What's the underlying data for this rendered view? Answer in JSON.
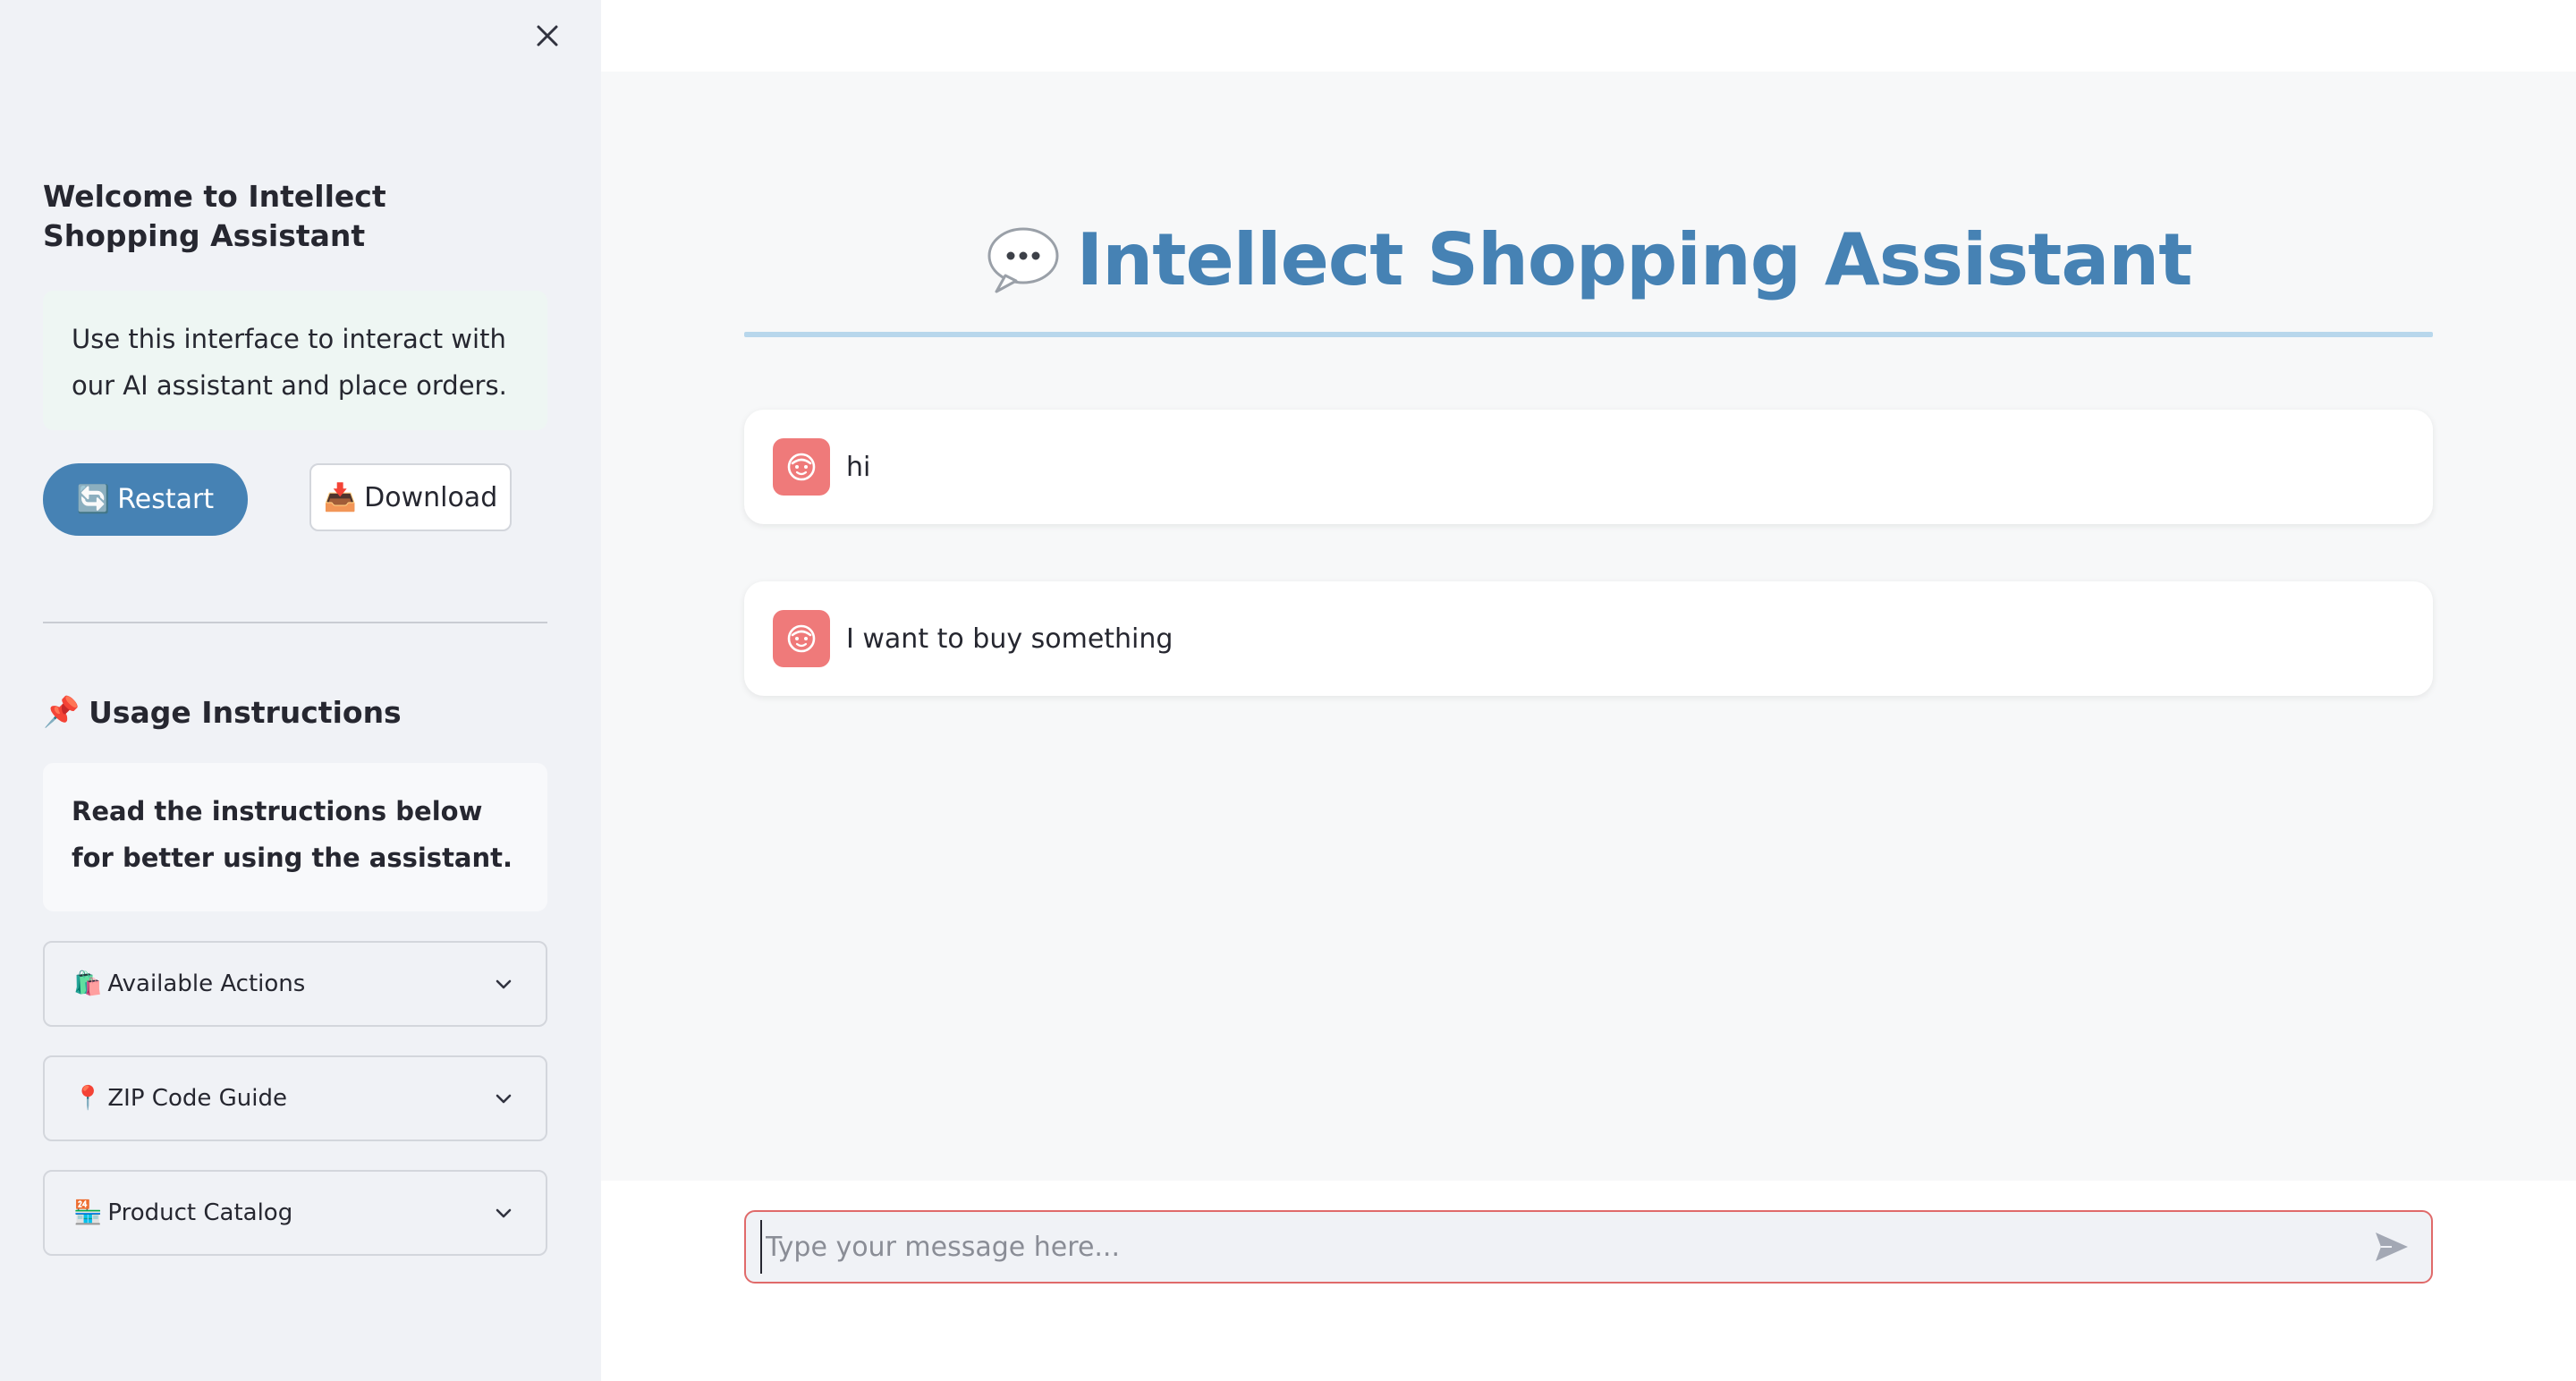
{
  "sidebar": {
    "heading": "Welcome to Intellect Shopping Assistant",
    "info_text": "Use this interface to interact with our AI assistant and place orders.",
    "restart_label": "Restart",
    "restart_emoji": "🔄",
    "download_label": "Download",
    "download_emoji": "📥",
    "usage_emoji": "📌",
    "usage_heading": "Usage Instructions",
    "usage_text": "Read the instructions below for better using the assistant.",
    "expanders": [
      {
        "emoji": "🛍️",
        "label": "Available Actions",
        "icon": "chevron-down-icon"
      },
      {
        "emoji": "📍",
        "label": "ZIP Code Guide",
        "icon": "chevron-down-icon"
      },
      {
        "emoji": "🏪",
        "label": "Product Catalog",
        "icon": "chevron-down-icon"
      }
    ],
    "close_icon": "close-icon"
  },
  "main": {
    "title_emoji": "💬",
    "title": "Intellect Shopping Assistant",
    "messages": [
      {
        "role": "user",
        "text": "hi",
        "icon": "user-face-icon"
      },
      {
        "role": "user",
        "text": "I want to buy something",
        "icon": "user-face-icon"
      }
    ],
    "chat_input": {
      "placeholder": "Type your message here...",
      "value": "",
      "send_icon": "send-icon"
    }
  },
  "colors": {
    "accent": "#4682b4",
    "sidebar_bg": "#f0f2f6",
    "avatar_bg": "#ef7a7a",
    "input_border": "#e06a6a"
  }
}
